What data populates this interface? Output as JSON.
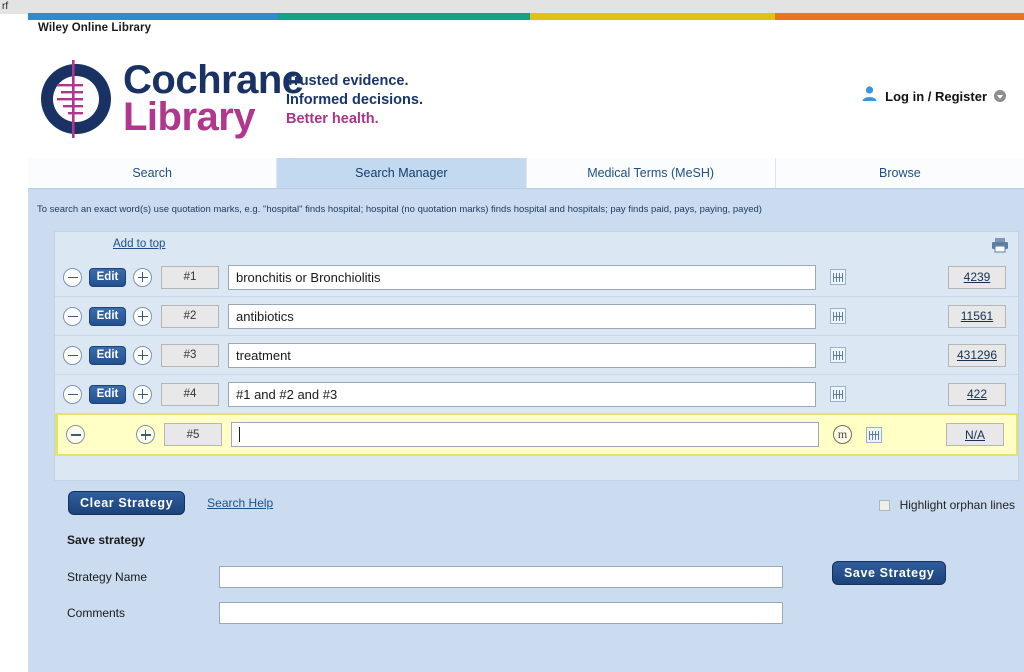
{
  "browser": {
    "tab_fragment_text": "rf"
  },
  "wiley": {
    "label": "Wiley Online Library",
    "bar_colors": [
      "#2e8ccd",
      "#16a085",
      "#e0c312",
      "#ea7521"
    ]
  },
  "brand": {
    "logo_line1": "Cochrane",
    "logo_line2": "Library",
    "tagline_1": "Trusted evidence.",
    "tagline_2": "Informed decisions.",
    "tagline_3": "Better health.",
    "logo_navy": "#1a3263",
    "logo_magenta": "#b0368e"
  },
  "account": {
    "login_label": "Log in / Register",
    "user_icon": "user-icon",
    "dropdown_icon": "chevron-down-icon"
  },
  "tabs": [
    {
      "label": "Search",
      "active": false
    },
    {
      "label": "Search Manager",
      "active": true
    },
    {
      "label": "Medical Terms (MeSH)",
      "active": false
    },
    {
      "label": "Browse",
      "active": false
    }
  ],
  "hint": "To search an exact word(s) use quotation marks, e.g. \"hospital\" finds hospital; hospital (no quotation marks) finds hospital and hospitals; pay finds paid, pays, paying, payed)",
  "search_manager": {
    "add_to_top_label": "Add to top",
    "print_icon": "printer-icon",
    "edit_label": "Edit",
    "remove_icon": "minus-circle-icon",
    "add_icon": "plus-circle-icon",
    "mesh_icon": "mesh-grid-icon",
    "mesh_m_icon": "mesh-m-circle-icon",
    "rows": [
      {
        "id": "#1",
        "query": "bronchitis or Bronchiolitis",
        "count": "4239",
        "editable": true,
        "highlight": false
      },
      {
        "id": "#2",
        "query": "antibiotics",
        "count": "11561",
        "editable": true,
        "highlight": false
      },
      {
        "id": "#3",
        "query": "treatment",
        "count": "431296",
        "editable": true,
        "highlight": false
      },
      {
        "id": "#4",
        "query": "#1 and #2 and #3",
        "count": "422",
        "editable": true,
        "highlight": false
      },
      {
        "id": "#5",
        "query": "",
        "count": "N/A",
        "editable": false,
        "highlight": true
      }
    ]
  },
  "actions": {
    "clear_strategy_label": "Clear Strategy",
    "search_help_label": "Search Help",
    "highlight_orphan_label": "Highlight orphan lines",
    "highlight_orphan_checked": false,
    "save_strategy_heading": "Save strategy",
    "strategy_name_label": "Strategy Name",
    "strategy_name_value": "",
    "comments_label": "Comments",
    "comments_value": "",
    "save_strategy_button": "Save Strategy"
  }
}
